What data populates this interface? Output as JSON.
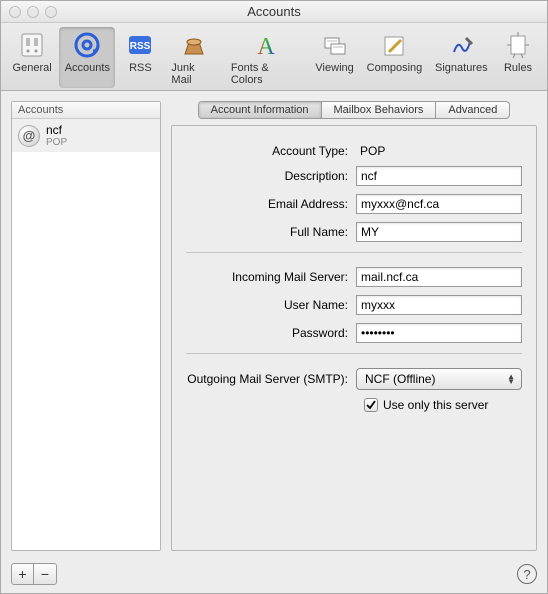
{
  "window": {
    "title": "Accounts"
  },
  "toolbar": {
    "items": [
      {
        "label": "General"
      },
      {
        "label": "Accounts"
      },
      {
        "label": "RSS"
      },
      {
        "label": "Junk Mail"
      },
      {
        "label": "Fonts & Colors"
      },
      {
        "label": "Viewing"
      },
      {
        "label": "Composing"
      },
      {
        "label": "Signatures"
      },
      {
        "label": "Rules"
      }
    ]
  },
  "sidebar": {
    "header": "Accounts",
    "items": [
      {
        "name": "ncf",
        "type": "POP"
      }
    ]
  },
  "tabs": {
    "items": [
      {
        "label": "Account Information"
      },
      {
        "label": "Mailbox Behaviors"
      },
      {
        "label": "Advanced"
      }
    ]
  },
  "form": {
    "account_type_label": "Account Type:",
    "account_type_value": "POP",
    "description_label": "Description:",
    "description_value": "ncf",
    "email_label": "Email Address:",
    "email_value": "myxxx@ncf.ca",
    "fullname_label": "Full Name:",
    "fullname_value": "MY",
    "incoming_label": "Incoming Mail Server:",
    "incoming_value": "mail.ncf.ca",
    "username_label": "User Name:",
    "username_value": "myxxx",
    "password_label": "Password:",
    "password_value": "••••••••",
    "smtp_label": "Outgoing Mail Server (SMTP):",
    "smtp_value": "NCF (Offline)",
    "use_only_label": "Use only this server"
  },
  "footer": {
    "plus": "+",
    "minus": "−",
    "help": "?"
  }
}
